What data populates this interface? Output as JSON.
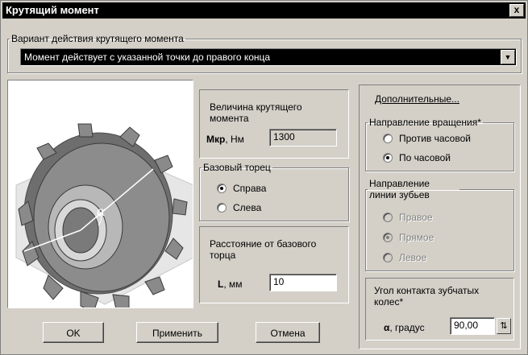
{
  "window": {
    "title": "Крутящий момент",
    "close_label": "x"
  },
  "variant": {
    "legend": "Вариант действия крутящего момента",
    "selected": "Момент действует с указанной точки до правого конца"
  },
  "torque": {
    "title": "Величина крутящего момента",
    "symbol": "Мкр",
    "unit": ", Нм",
    "value": "1300"
  },
  "base_face": {
    "legend": "Базовый торец",
    "options": [
      {
        "label": "Справа",
        "checked": true
      },
      {
        "label": "Слева",
        "checked": false
      }
    ]
  },
  "distance": {
    "title": "Расстояние от базового торца",
    "symbol": "L",
    "unit": ", мм",
    "value": "10"
  },
  "extra_link": "Дополнительные...",
  "rotation": {
    "legend": "Направление вращения*",
    "options": [
      {
        "label": "Против часовой",
        "checked": false
      },
      {
        "label": "По часовой",
        "checked": true
      }
    ]
  },
  "tooth_line": {
    "legend": "Направление линии зубьев",
    "options": [
      {
        "label": "Правое",
        "checked": false
      },
      {
        "label": "Прямое",
        "checked": true
      },
      {
        "label": "Левое",
        "checked": false
      }
    ]
  },
  "contact_angle": {
    "title": "Угол контакта зубчатых колес*",
    "symbol": "α",
    "unit": ", градус",
    "value": "90,00"
  },
  "buttons": {
    "ok": "OK",
    "apply": "Применить",
    "cancel": "Отмена"
  },
  "image_label": "α"
}
